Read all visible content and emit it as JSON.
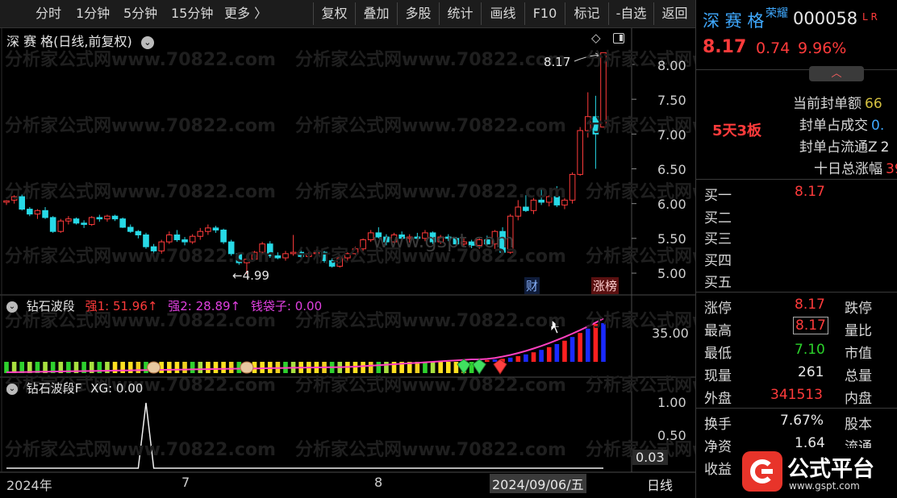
{
  "toolbar": {
    "period_items": [
      "分时",
      "1分钟",
      "5分钟",
      "15分钟",
      "更多 〉"
    ],
    "buttons": [
      "复权",
      "叠加",
      "多股",
      "统计",
      "画线",
      "F10",
      "标记",
      "-自选",
      "返回"
    ]
  },
  "main_chart": {
    "title": "深 赛 格(日线,前复权)",
    "y_ticks": [
      "8.00",
      "7.50",
      "7.00",
      "6.50",
      "6.00",
      "5.50",
      "5.00"
    ],
    "high_label": "8.17",
    "low_label": "←4.99",
    "tags": [
      "财",
      "涨榜"
    ]
  },
  "indicator1": {
    "name": "钻石波段",
    "q1": "强1: 51.96↑",
    "q2": "强2: 28.89↑",
    "qdz": "钱袋子: 0.00",
    "y_tick": "35.00"
  },
  "indicator2": {
    "name": "钻石波段F",
    "xg": "XG: 0.00",
    "y_ticks": [
      "1.00",
      "0.50"
    ],
    "last_value": "0.03"
  },
  "x_axis": {
    "labels": [
      "2024年",
      "7",
      "8"
    ],
    "cursor_date": "2024/09/06/五",
    "period": "日线"
  },
  "watermark": "分析家公式网www.70822.com",
  "center_watermark": "www.gspt.com",
  "right_panel": {
    "stock_name": "深 赛 格",
    "badge": "荣耀",
    "code": "000058",
    "market": "L R",
    "price": "8.17",
    "change": "0.74",
    "change_pct": "9.96%",
    "streak": "5天3板",
    "metrics": [
      {
        "label": "当前封单额",
        "value": "66"
      },
      {
        "label": "封单占成交",
        "value": "0."
      },
      {
        "label": "封单占流通Z",
        "value": "2"
      },
      {
        "label": "十日总涨幅",
        "value": "39"
      }
    ],
    "bids": [
      {
        "label": "买一",
        "value": "8.17"
      },
      {
        "label": "买二",
        "value": ""
      },
      {
        "label": "买三",
        "value": ""
      },
      {
        "label": "买四",
        "value": ""
      },
      {
        "label": "买五",
        "value": ""
      }
    ],
    "stats": [
      {
        "label": "涨停",
        "value": "8.17",
        "label2": "跌停"
      },
      {
        "label": "最高",
        "value": "8.17",
        "label2": "量比"
      },
      {
        "label": "最低",
        "value": "7.10",
        "label2": "市值"
      },
      {
        "label": "现量",
        "value": "261",
        "label2": "总量"
      },
      {
        "label": "外盘",
        "value": "341513",
        "label2": "内盘"
      }
    ],
    "stats2": [
      {
        "label": "换手",
        "value": "7.67%",
        "label2": "股本"
      },
      {
        "label": "净资",
        "value": "1.64",
        "label2": "流通"
      },
      {
        "label": "收益",
        "value": "",
        "label2": ""
      }
    ]
  },
  "logo": {
    "text": "公式平台",
    "url": "www.gspt.com"
  },
  "chart_data": {
    "type": "candlestick",
    "ylim": [
      4.8,
      8.3
    ],
    "candles": [
      [
        6.02,
        6.05,
        5.98,
        6.04
      ],
      [
        6.05,
        6.12,
        6.0,
        6.1
      ],
      [
        6.1,
        6.13,
        5.9,
        5.92
      ],
      [
        5.92,
        5.95,
        5.82,
        5.85
      ],
      [
        5.85,
        5.92,
        5.78,
        5.9
      ],
      [
        5.9,
        5.95,
        5.78,
        5.8
      ],
      [
        5.8,
        5.82,
        5.58,
        5.6
      ],
      [
        5.6,
        5.78,
        5.58,
        5.75
      ],
      [
        5.75,
        5.82,
        5.7,
        5.78
      ],
      [
        5.78,
        5.8,
        5.7,
        5.72
      ],
      [
        5.72,
        5.76,
        5.65,
        5.7
      ],
      [
        5.7,
        5.82,
        5.68,
        5.8
      ],
      [
        5.8,
        5.84,
        5.74,
        5.78
      ],
      [
        5.78,
        5.84,
        5.74,
        5.82
      ],
      [
        5.82,
        5.84,
        5.75,
        5.78
      ],
      [
        5.78,
        5.8,
        5.65,
        5.66
      ],
      [
        5.66,
        5.7,
        5.58,
        5.6
      ],
      [
        5.6,
        5.62,
        5.5,
        5.55
      ],
      [
        5.55,
        5.58,
        5.35,
        5.38
      ],
      [
        5.38,
        5.42,
        5.28,
        5.32
      ],
      [
        5.32,
        5.48,
        5.28,
        5.45
      ],
      [
        5.45,
        5.6,
        5.42,
        5.55
      ],
      [
        5.55,
        5.62,
        5.45,
        5.48
      ],
      [
        5.48,
        5.52,
        5.4,
        5.45
      ],
      [
        5.45,
        5.56,
        5.42,
        5.53
      ],
      [
        5.53,
        5.65,
        5.48,
        5.6
      ],
      [
        5.6,
        5.7,
        5.55,
        5.65
      ],
      [
        5.65,
        5.68,
        5.58,
        5.62
      ],
      [
        5.62,
        5.64,
        5.42,
        5.45
      ],
      [
        5.45,
        5.48,
        5.25,
        5.28
      ],
      [
        5.28,
        5.3,
        5.12,
        5.15
      ],
      [
        5.15,
        5.22,
        4.99,
        5.2
      ],
      [
        5.2,
        5.32,
        5.18,
        5.3
      ],
      [
        5.3,
        5.45,
        5.28,
        5.42
      ],
      [
        5.42,
        5.46,
        5.22,
        5.25
      ],
      [
        5.25,
        5.3,
        5.2,
        5.22
      ],
      [
        5.22,
        5.32,
        5.18,
        5.28
      ],
      [
        5.28,
        5.55,
        5.25,
        5.3
      ],
      [
        5.3,
        5.33,
        5.22,
        5.24
      ],
      [
        5.24,
        5.3,
        5.2,
        5.28
      ],
      [
        5.28,
        5.34,
        5.24,
        5.3
      ],
      [
        5.3,
        5.32,
        5.15,
        5.18
      ],
      [
        5.18,
        5.22,
        5.08,
        5.1
      ],
      [
        5.1,
        5.25,
        5.08,
        5.22
      ],
      [
        5.22,
        5.3,
        5.18,
        5.28
      ],
      [
        5.28,
        5.38,
        5.25,
        5.35
      ],
      [
        5.35,
        5.5,
        5.32,
        5.48
      ],
      [
        5.48,
        5.62,
        5.45,
        5.58
      ],
      [
        5.58,
        5.66,
        5.5,
        5.52
      ],
      [
        5.52,
        5.56,
        5.4,
        5.45
      ],
      [
        5.45,
        5.58,
        5.42,
        5.55
      ],
      [
        5.55,
        5.6,
        5.46,
        5.5
      ],
      [
        5.5,
        5.56,
        5.44,
        5.52
      ],
      [
        5.52,
        5.58,
        5.46,
        5.5
      ],
      [
        5.5,
        5.62,
        5.46,
        5.58
      ],
      [
        5.58,
        5.6,
        5.42,
        5.45
      ],
      [
        5.45,
        5.55,
        5.42,
        5.52
      ],
      [
        5.52,
        5.56,
        5.46,
        5.5
      ],
      [
        5.5,
        5.52,
        5.4,
        5.42
      ],
      [
        5.42,
        5.5,
        5.38,
        5.45
      ],
      [
        5.45,
        5.48,
        5.36,
        5.4
      ],
      [
        5.4,
        5.5,
        5.35,
        5.48
      ],
      [
        5.48,
        5.54,
        5.4,
        5.42
      ],
      [
        5.42,
        5.62,
        5.35,
        5.6
      ],
      [
        5.6,
        5.66,
        5.28,
        5.3
      ],
      [
        5.3,
        5.85,
        5.28,
        5.82
      ],
      [
        5.82,
        6.05,
        5.76,
        5.95
      ],
      [
        5.95,
        6.12,
        5.88,
        5.9
      ],
      [
        5.9,
        6.08,
        5.85,
        6.05
      ],
      [
        6.05,
        6.2,
        5.98,
        6.02
      ],
      [
        6.02,
        6.12,
        5.96,
        6.1
      ],
      [
        6.1,
        6.25,
        5.95,
        5.98
      ],
      [
        5.98,
        6.08,
        5.92,
        6.05
      ],
      [
        6.05,
        6.45,
        6.0,
        6.42
      ],
      [
        6.42,
        7.1,
        6.4,
        7.05
      ],
      [
        7.05,
        7.6,
        6.95,
        7.25
      ],
      [
        7.25,
        7.55,
        6.5,
        7.0
      ],
      [
        7.1,
        8.17,
        7.1,
        8.17
      ]
    ],
    "indicator2_series": [
      0,
      0,
      0,
      0,
      0,
      0,
      0,
      0,
      0,
      0,
      0,
      0,
      0,
      0,
      0,
      0,
      0,
      0,
      1,
      0,
      0,
      0,
      0,
      0,
      0,
      0,
      0,
      0,
      0,
      0,
      0,
      0,
      0,
      0,
      0,
      0,
      0,
      0,
      0,
      0,
      0,
      0,
      0,
      0,
      0,
      0,
      0,
      0,
      0,
      0,
      0,
      0,
      0,
      0,
      0,
      0,
      0,
      0,
      0,
      0,
      0,
      0,
      0,
      0,
      0,
      0,
      0,
      0,
      0,
      0,
      0,
      0,
      0,
      0,
      0,
      0,
      0,
      0
    ]
  }
}
